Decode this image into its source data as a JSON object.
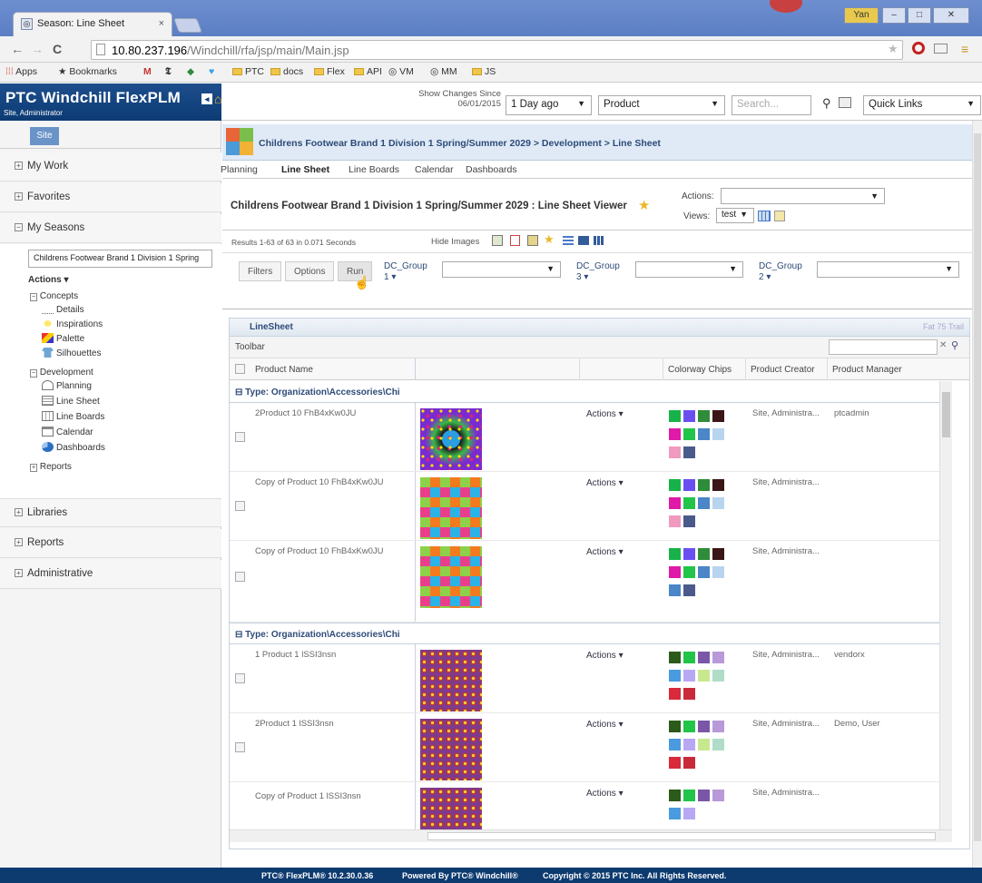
{
  "browser": {
    "tab_title": "Season: Line Sheet",
    "tab_close": "×",
    "url_host": "10.80.237.196",
    "url_path": "/Windchill/rfa/jsp/main/Main.jsp",
    "user_badge": "Yan",
    "bookmarks": [
      "Apps",
      "Bookmarks",
      "PTC",
      "docs",
      "Flex",
      "API",
      "VM",
      "MM",
      "JS"
    ]
  },
  "header": {
    "logo": "PTC Windchill FlexPLM",
    "user": "Site, Administrator",
    "show_changes_label": "Show Changes Since",
    "show_changes_date": "06/01/2015",
    "period": "1 Day ago",
    "type_select": "Product",
    "search_placeholder": "Search...",
    "quick_links": "Quick Links"
  },
  "sidebar": {
    "site_tab": "Site",
    "sections": {
      "my_work": "My Work",
      "favorites": "Favorites",
      "my_seasons": "My Seasons",
      "libraries": "Libraries",
      "reports": "Reports",
      "administrative": "Administrative"
    },
    "season_select": "Childrens Footwear Brand 1 Division 1 Spring",
    "actions": "Actions",
    "concepts": "Concepts",
    "concept_items": [
      "Details",
      "Inspirations",
      "Palette",
      "Silhouettes"
    ],
    "development": "Development",
    "development_items": [
      "Planning",
      "Line Sheet",
      "Line Boards",
      "Calendar",
      "Dashboards"
    ],
    "reports": "Reports"
  },
  "breadcrumb": {
    "season": "Childrens Footwear Brand 1 Division 1 Spring/Summer 2029",
    "sep": ">",
    "development": "Development",
    "current": "Line Sheet"
  },
  "subnav": [
    "Planning",
    "Line Sheet",
    "Line Boards",
    "Calendar",
    "Dashboards"
  ],
  "viewer": {
    "title": "Childrens Footwear Brand 1 Division 1 Spring/Summer 2029 : Line Sheet Viewer",
    "actions_label": "Actions:",
    "views_label": "Views:",
    "views_value": "test",
    "results": "Results 1-63 of 63 in 0.071 Seconds",
    "hide_images": "Hide Images"
  },
  "filters": {
    "filters_btn": "Filters",
    "options_btn": "Options",
    "run_btn": "Run",
    "dc1_label": "DC_Group",
    "dc1_num": "1",
    "dc3_label": "DC_Group",
    "dc3_num": "3",
    "dc2_label": "DC_Group",
    "dc2_num": "2"
  },
  "grid": {
    "title": "LineSheet",
    "title_right": "Fat 75 Trail",
    "toolbar": "Toolbar",
    "columns": {
      "product_name": "Product Name",
      "colorway_chips": "Colorway Chips",
      "product_creator": "Product Creator",
      "product_manager": "Product Manager"
    },
    "groups": [
      "Type: Organization\\Accessories\\Chi",
      "Type: Organization\\Accessories\\Chi"
    ],
    "rows": [
      {
        "name": "2Product 10 FhB4xKw0JU",
        "actions": "Actions",
        "creator": "Site, Administra...",
        "manager": "ptcadmin"
      },
      {
        "name": "Copy of Product 10 FhB4xKw0JU",
        "actions": "Actions",
        "creator": "Site, Administra...",
        "manager": ""
      },
      {
        "name": "Copy of Product 10 FhB4xKw0JU",
        "actions": "Actions",
        "creator": "Site, Administra...",
        "manager": ""
      },
      {
        "name": "1 Product 1 lSSI3nsn",
        "actions": "Actions",
        "creator": "Site, Administra...",
        "manager": "vendorx"
      },
      {
        "name": "2Product 1 lSSI3nsn",
        "actions": "Actions",
        "creator": "Site, Administra...",
        "manager": "Demo, User"
      },
      {
        "name": "Copy of Product 1 lSSI3nsn",
        "actions": "Actions",
        "creator": "Site, Administra...",
        "manager": ""
      }
    ]
  },
  "footer": {
    "version": "PTC® FlexPLM® 10.2.30.0.36",
    "powered": "Powered By PTC® Windchill®",
    "copyright": "Copyright © 2015 PTC Inc. All Rights Reserved."
  },
  "colors": {
    "header_blue": "#0d3a6f",
    "breadcrumb_bg": "#dfeaf6",
    "group_text": "#2d4a78"
  }
}
